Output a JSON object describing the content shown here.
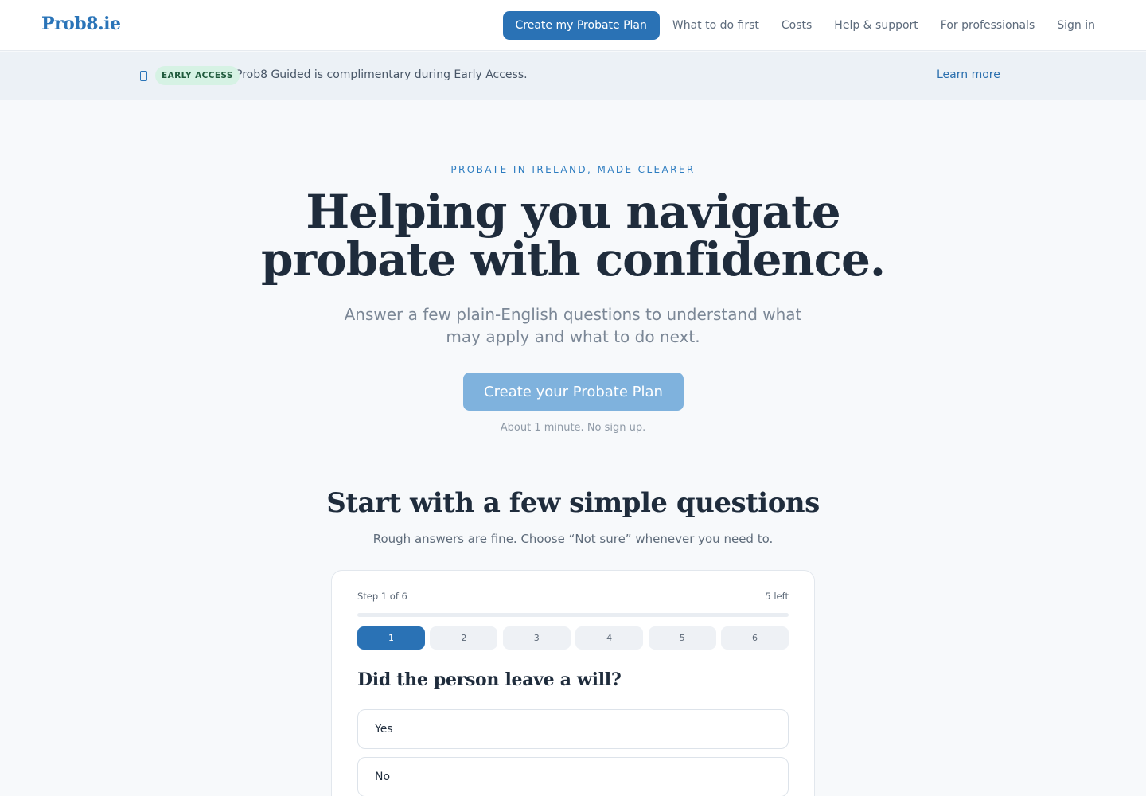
{
  "header": {
    "logo": "Prob8.ie",
    "cta_label": "Create my Probate Plan",
    "nav": [
      "What to do first",
      "Costs",
      "Help & support",
      "For professionals",
      "Sign in"
    ]
  },
  "banner": {
    "icon": "info-icon",
    "badge": "EARLY ACCESS",
    "text": "Prob8 Guided is complimentary during Early Access.",
    "link": "Learn more"
  },
  "hero": {
    "eyebrow": "PROBATE IN IRELAND, MADE CLEARER",
    "title": "Helping you navigate probate with confidence.",
    "subtitle": "Answer a few plain-English questions to understand what may apply and what to do next.",
    "cta_label": "Create your Probate Plan",
    "note": "About 1 minute. No sign up."
  },
  "questions": {
    "title": "Start with a few simple questions",
    "subtitle": "Rough answers are fine. Choose “Not sure” whenever you need to.",
    "step_label": "Step 1 of 6",
    "steps_left": "5 left",
    "progress_fraction": 0.0,
    "steps": [
      "1",
      "2",
      "3",
      "4",
      "5",
      "6"
    ],
    "active_step": 0,
    "question": "Did the person leave a will?",
    "options": [
      "Yes",
      "No"
    ]
  },
  "colors": {
    "brand": "#2a72b5",
    "cta_disabled": "#7fb2dd",
    "badge_bg": "#d6f2e4",
    "banner_bg": "#ecf1f6"
  }
}
